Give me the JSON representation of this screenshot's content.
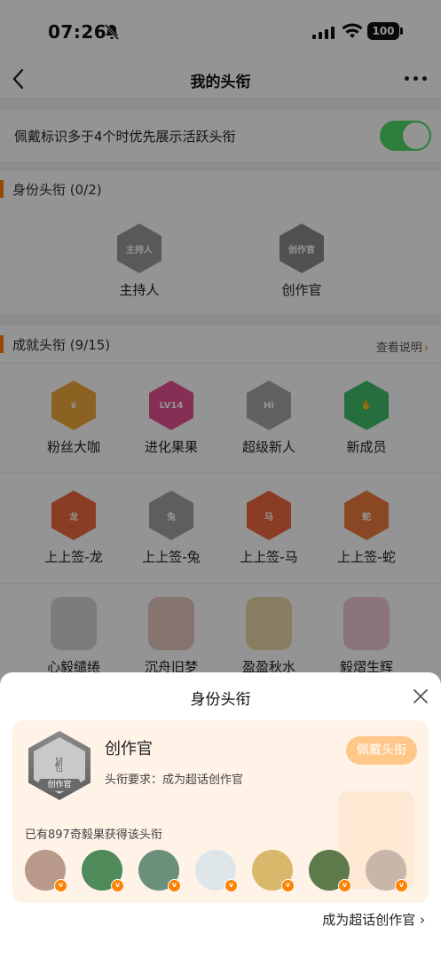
{
  "status_bar": {
    "time": "07:26",
    "battery": "100"
  },
  "nav": {
    "title": "我的头衔"
  },
  "settings": {
    "toggle_label": "佩戴标识多于4个时优先展示活跃头衔",
    "toggle_on": true
  },
  "identity_section": {
    "title": "身份头衔 (0/2)",
    "badges": [
      {
        "label": "主持人",
        "badge_text": "主持人",
        "icon": "microphone-badge-icon",
        "color": "#9a9a9a"
      },
      {
        "label": "创作官",
        "badge_text": "创作官",
        "icon": "creator-badge-icon",
        "color": "#8c8c8c"
      }
    ]
  },
  "achievement_section": {
    "title": "成就头衔 (9/15)",
    "link": "查看说明",
    "row1": [
      {
        "label": "粉丝大咖",
        "badge_text": "♛",
        "icon": "crown-badge-icon",
        "color": "#f2a93b"
      },
      {
        "label": "进化果果",
        "badge_text": "LV14",
        "icon": "level-badge-icon",
        "color": "#e7508f"
      },
      {
        "label": "超级新人",
        "badge_text": "Hi",
        "icon": "hi-badge-icon",
        "color": "#a8a8a8"
      },
      {
        "label": "新成员",
        "badge_text": "✋",
        "icon": "hand-badge-icon",
        "color": "#3fbf6a"
      }
    ],
    "row2": [
      {
        "label": "上上签-龙",
        "badge_text": "龙",
        "icon": "dragon-badge-icon",
        "color": "#ee6a3e"
      },
      {
        "label": "上上签-兔",
        "badge_text": "兔",
        "icon": "rabbit-badge-icon",
        "color": "#a3a3a3"
      },
      {
        "label": "上上签-马",
        "badge_text": "马",
        "icon": "horse-badge-icon",
        "color": "#ee6a3e"
      },
      {
        "label": "上上签-蛇",
        "badge_text": "蛇",
        "icon": "snake-badge-icon",
        "color": "#ee7a3e"
      }
    ],
    "row3": [
      {
        "label": "心毅缱绻",
        "icon": "character-badge-icon",
        "color": "#d6d6d6"
      },
      {
        "label": "沉舟旧梦",
        "icon": "character-badge-icon",
        "color": "#e6c9c0"
      },
      {
        "label": "盈盈秋水",
        "icon": "character-badge-icon",
        "color": "#e9d9a8"
      },
      {
        "label": "毅熠生辉",
        "icon": "character-badge-icon",
        "color": "#f0c8d8"
      }
    ]
  },
  "sheet": {
    "title": "身份头衔",
    "badge_name": "创作官",
    "badge_logo_text": "创作官",
    "requirement": "头衔要求：成为超话创作官",
    "wear_button": "佩戴头衔",
    "holders_text": "已有897奇毅果获得该头衔",
    "avatars": [
      {
        "icon": "user-avatar",
        "color": "#b99a8a"
      },
      {
        "icon": "user-avatar",
        "color": "#4f8a5a"
      },
      {
        "icon": "user-avatar",
        "color": "#6a8f7a"
      },
      {
        "icon": "user-avatar",
        "color": "#dfe6ea"
      },
      {
        "icon": "user-avatar",
        "color": "#d8b86a"
      },
      {
        "icon": "user-avatar",
        "color": "#5d7a4a"
      },
      {
        "icon": "user-avatar",
        "color": "#c9b6aa"
      }
    ],
    "verified_mark": "v",
    "become_link": "成为超话创作官"
  }
}
